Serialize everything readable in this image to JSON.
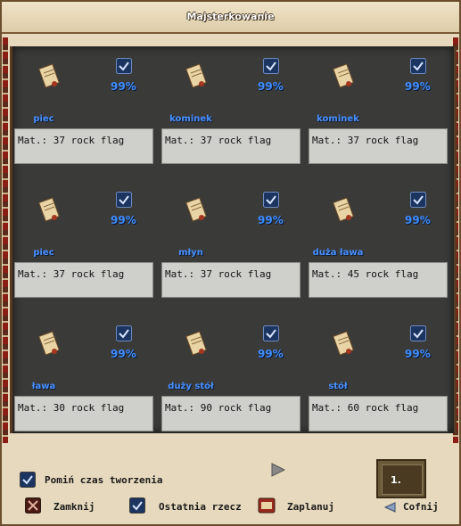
{
  "window": {
    "title": "Majsterkowanie"
  },
  "recipes": [
    {
      "name": "piec",
      "chance": "99%",
      "materials": "Mat.: 37 rock flag"
    },
    {
      "name": "kominek",
      "chance": "99%",
      "materials": "Mat.: 37 rock flag"
    },
    {
      "name": "kominek",
      "chance": "99%",
      "materials": "Mat.: 37 rock flag"
    },
    {
      "name": "piec",
      "chance": "99%",
      "materials": "Mat.: 37 rock flag"
    },
    {
      "name": "młyn",
      "chance": "99%",
      "materials": "Mat.: 37 rock flag"
    },
    {
      "name": "duża ława",
      "chance": "99%",
      "materials": "Mat.: 45 rock flag"
    },
    {
      "name": "ława",
      "chance": "99%",
      "materials": "Mat.: 30 rock flag"
    },
    {
      "name": "duży stół",
      "chance": "99%",
      "materials": "Mat.: 90 rock flag"
    },
    {
      "name": "stół",
      "chance": "99%",
      "materials": "Mat.: 60 rock flag"
    }
  ],
  "footer": {
    "skip_time_label": "Pomiń czas tworzenia",
    "close_label": "Zamknij",
    "last_item_label": "Ostatnia rzecz",
    "schedule_label": "Zaplanuj",
    "back_label": "Cofnij",
    "quantity": "1."
  },
  "colors": {
    "accent_blue": "#3f8dff",
    "panel_bg": "#3a3a38",
    "frame": "#e6d9bd"
  }
}
